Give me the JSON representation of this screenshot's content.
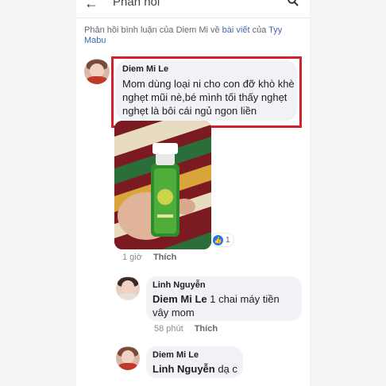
{
  "header": {
    "title": "Phản hồi"
  },
  "context": {
    "prefix": "Phản hồi bình luận của Diem Mi về ",
    "post_link": "bài viết",
    "middle": " của ",
    "owner": "Tyy Mabu"
  },
  "comments": [
    {
      "author": "Diem Mi Le",
      "text": "Mom dùng loại ni cho con đỡ khò khè nghẹt mũi nè,bé mình tối thấy nghẹt nghẹt là bôi cái ngủ ngon liền",
      "time": "1 giờ",
      "action": "Thích",
      "reaction_count": "1"
    },
    {
      "author": "Linh Nguyễn",
      "mention": "Diem Mi Le",
      "text": " 1 chai máy tiền vây mom",
      "time": "58 phút",
      "action": "Thích"
    },
    {
      "author": "Diem Mi Le",
      "mention": "Linh Nguyễn",
      "text": " dạ c"
    }
  ],
  "colors": {
    "highlight_border": "#d4202a",
    "link": "#4267b2",
    "like": "#1877f2"
  },
  "icons": [
    "back-arrow-icon",
    "search-icon",
    "like-icon"
  ]
}
